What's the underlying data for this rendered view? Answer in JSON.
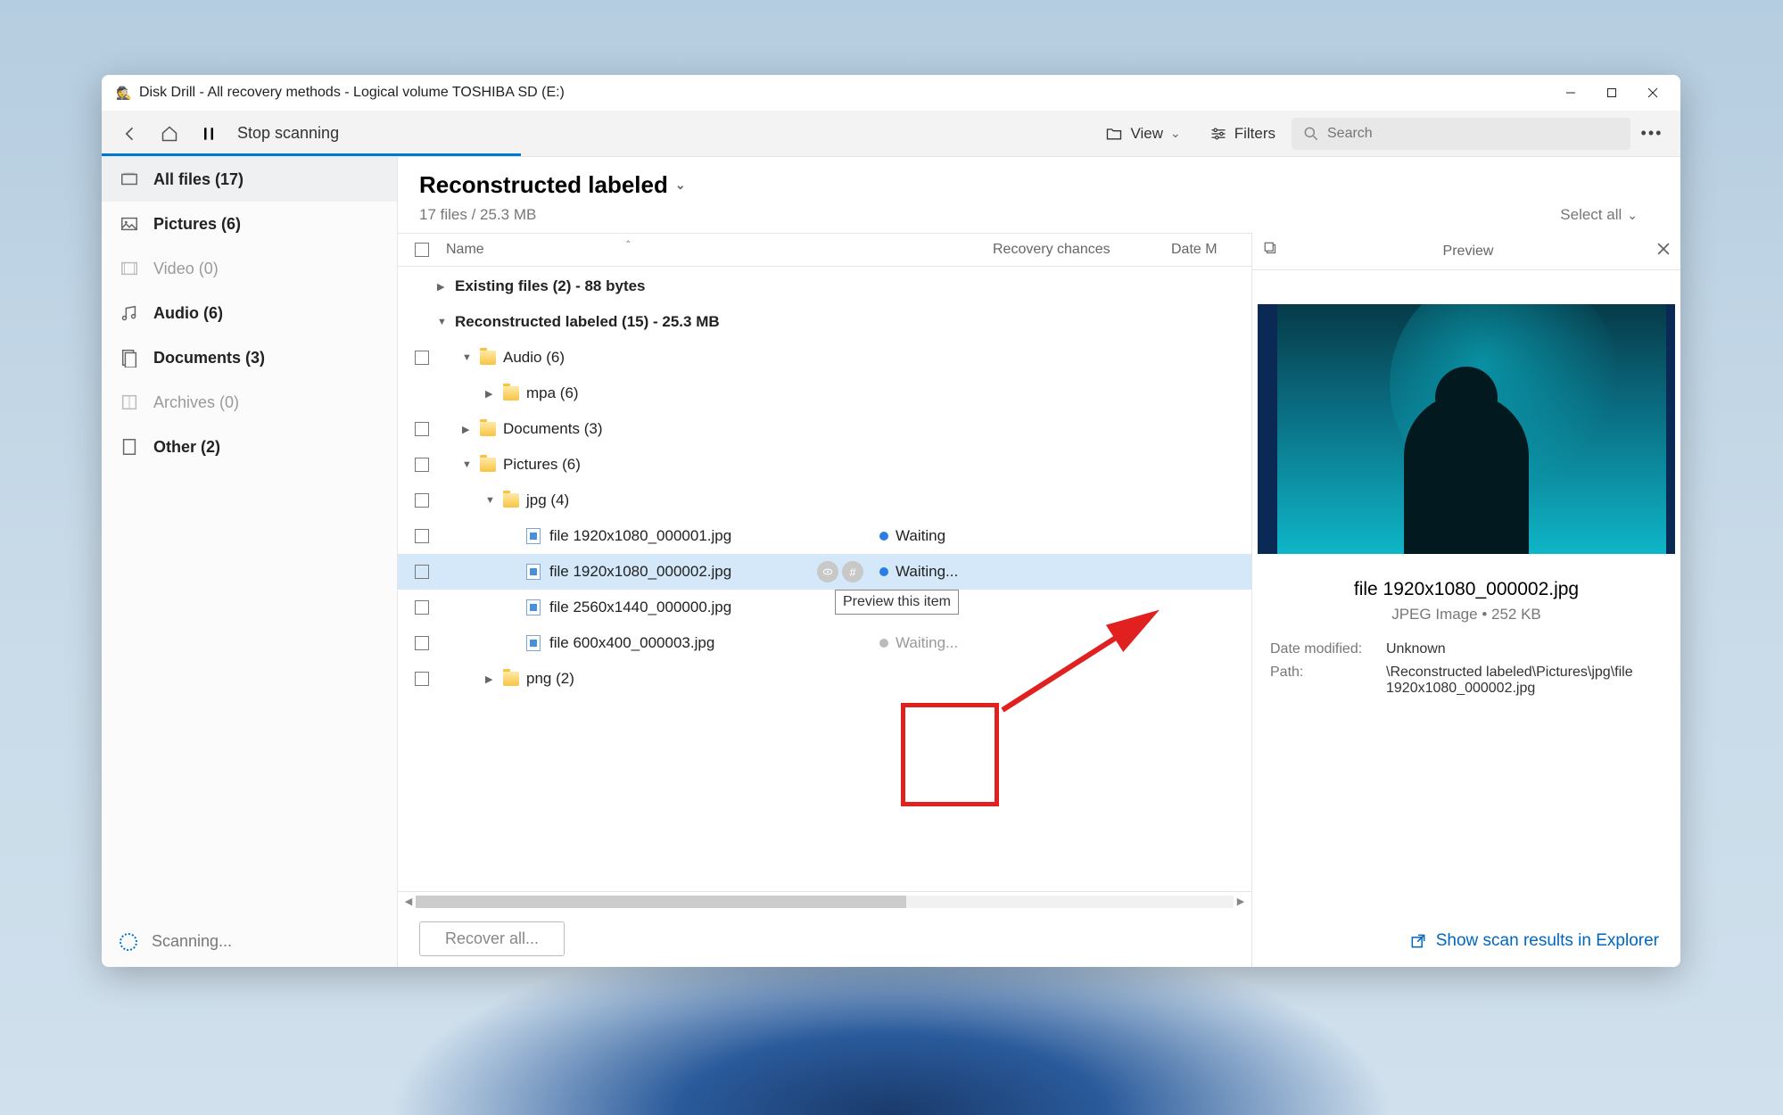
{
  "window": {
    "title": "Disk Drill - All recovery methods - Logical volume TOSHIBA SD (E:)"
  },
  "toolbar": {
    "stop_label": "Stop scanning",
    "view_label": "View",
    "filters_label": "Filters",
    "search_placeholder": "Search"
  },
  "sidebar": {
    "items": [
      {
        "label": "All files (17)",
        "selected": true
      },
      {
        "label": "Pictures (6)"
      },
      {
        "label": "Video (0)",
        "muted": true
      },
      {
        "label": "Audio (6)"
      },
      {
        "label": "Documents (3)"
      },
      {
        "label": "Archives (0)",
        "muted": true
      },
      {
        "label": "Other (2)"
      }
    ],
    "scanning_label": "Scanning..."
  },
  "main": {
    "title": "Reconstructed labeled",
    "subtitle": "17 files / 25.3 MB",
    "select_all": "Select all",
    "columns": {
      "name": "Name",
      "recovery": "Recovery chances",
      "date": "Date M"
    },
    "groups": {
      "existing": "Existing files (2) - 88 bytes",
      "reconstructed": "Reconstructed labeled (15) - 25.3 MB",
      "audio": "Audio (6)",
      "mpa": "mpa (6)",
      "documents": "Documents (3)",
      "pictures": "Pictures (6)",
      "jpg": "jpg (4)",
      "png": "png (2)"
    },
    "files": [
      {
        "name": "file 1920x1080_000001.jpg",
        "status": "Waiting"
      },
      {
        "name": "file 1920x1080_000002.jpg",
        "status": "Waiting...",
        "selected": true
      },
      {
        "name": "file 2560x1440_000000.jpg",
        "status_suffix": "..."
      },
      {
        "name": "file 600x400_000003.jpg",
        "status": "Waiting..."
      }
    ],
    "tooltip": "Preview this item",
    "recover_label": "Recover all..."
  },
  "preview": {
    "header": "Preview",
    "filename": "file 1920x1080_000002.jpg",
    "filetype": "JPEG Image • 252 KB",
    "date_modified_k": "Date modified:",
    "date_modified_v": "Unknown",
    "path_k": "Path:",
    "path_v": "\\Reconstructed labeled\\Pictures\\jpg\\file 1920x1080_000002.jpg",
    "explorer_link": "Show scan results in Explorer"
  }
}
